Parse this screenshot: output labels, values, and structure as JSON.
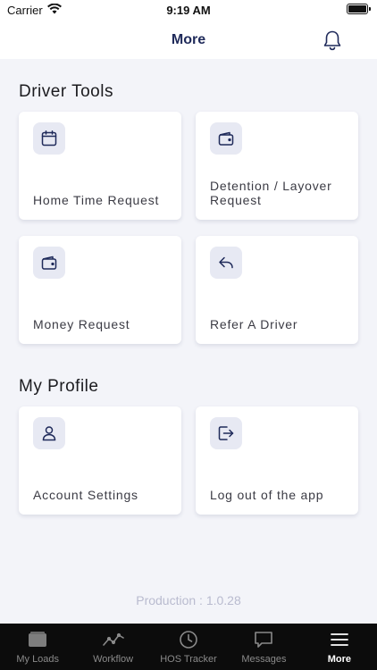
{
  "status_bar": {
    "carrier": "Carrier",
    "time": "9:19 AM"
  },
  "header": {
    "title": "More"
  },
  "sections": {
    "driver_tools": {
      "title": "Driver Tools",
      "cards": [
        {
          "label": "Home Time Request",
          "icon": "calendar-icon"
        },
        {
          "label": "Detention / Layover Request",
          "icon": "wallet-icon"
        },
        {
          "label": "Money Request",
          "icon": "wallet-icon"
        },
        {
          "label": "Refer A Driver",
          "icon": "reply-icon"
        }
      ]
    },
    "my_profile": {
      "title": "My Profile",
      "cards": [
        {
          "label": "Account Settings",
          "icon": "user-icon"
        },
        {
          "label": "Log out of the app",
          "icon": "logout-icon"
        }
      ]
    }
  },
  "version": "Production : 1.0.28",
  "tabs": [
    {
      "label": "My Loads",
      "icon": "truck-icon"
    },
    {
      "label": "Workflow",
      "icon": "workflow-icon"
    },
    {
      "label": "HOS Tracker",
      "icon": "clock-icon"
    },
    {
      "label": "Messages",
      "icon": "message-icon"
    },
    {
      "label": "More",
      "icon": "menu-icon",
      "active": true
    }
  ],
  "colors": {
    "accent": "#1f2a5a",
    "icon_bg": "#e7e9f3",
    "background": "#f3f4f9",
    "tab_bar": "#0c0c0c"
  }
}
